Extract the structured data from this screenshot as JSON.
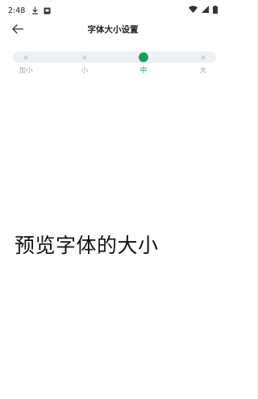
{
  "status_bar": {
    "time": "2:48"
  },
  "header": {
    "title": "字体大小设置",
    "back_icon": "arrow-left-icon"
  },
  "font_size_slider": {
    "labels": [
      "加小",
      "小",
      "中",
      "大"
    ],
    "selected_index": 2,
    "accent_color": "#17a055"
  },
  "preview": {
    "text": "预览字体的大小"
  }
}
